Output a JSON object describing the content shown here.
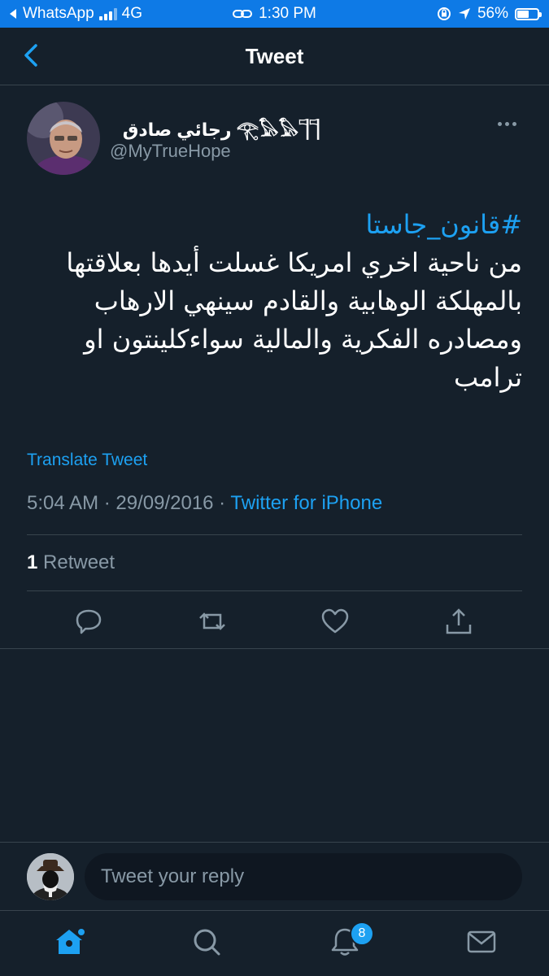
{
  "status_bar": {
    "back_app": "WhatsApp",
    "network": "4G",
    "time": "1:30 PM",
    "battery": "56%"
  },
  "nav": {
    "title": "Tweet"
  },
  "tweet": {
    "display_name": "رجائي صادق 𓂀𓅃𓅃𓊹𓊹",
    "handle": "@MyTrueHope",
    "hashtag": "#قانون_جاستا",
    "body": "من ناحية اخري امريكا غسلت أيدها بعلاقتها بالمهلكة الوهابية والقادم سينهي الارهاب ومصادره الفكرية والمالية سواءكلينتون او ترامب",
    "translate_label": "Translate Tweet",
    "time": "5:04 AM",
    "date": "29/09/2016",
    "source": "Twitter for iPhone",
    "retweet_count": "1",
    "retweet_label": "Retweet"
  },
  "actions": [
    "reply-icon",
    "retweet-icon",
    "like-icon",
    "share-icon"
  ],
  "reply": {
    "placeholder": "Tweet your reply"
  },
  "tabbar": {
    "tabs": [
      "home-icon",
      "search-icon",
      "notifications-icon",
      "messages-icon"
    ],
    "notification_badge": "8"
  },
  "colors": {
    "background": "#15202b",
    "accent": "#1da1f2",
    "muted": "#8899a6",
    "status_bar": "#0e7ae6"
  }
}
